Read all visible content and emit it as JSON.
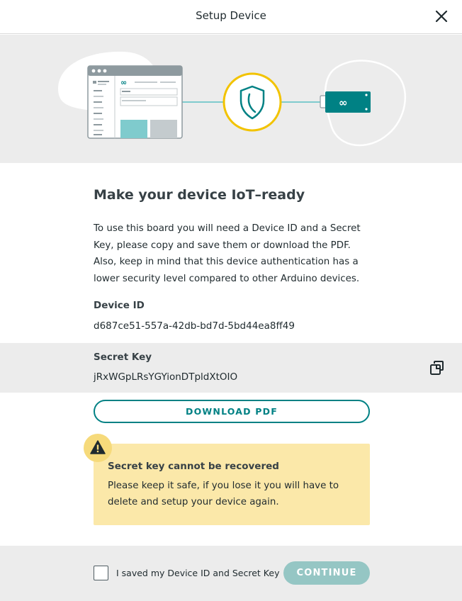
{
  "header": {
    "title": "Setup Device",
    "close_icon": "close-icon"
  },
  "hero": {
    "description_icons": [
      "browser-window-illustration",
      "shield-icon",
      "arduino-board-illustration"
    ],
    "accent_color": "#008184",
    "shield_ring_color": "#f2c300"
  },
  "main": {
    "title": "Make your device IoT–ready",
    "description": "To use this board you will need a Device ID and a Secret Key, please copy and save them or download the PDF. Also, keep in mind that this device authentication has a lower security level compared to other Arduino devices.",
    "device_id": {
      "label": "Device ID",
      "value": "d687ce51-557a-42db-bd7d-5bd44ea8ff49"
    },
    "secret_key": {
      "label": "Secret Key",
      "value": "jRxWGpLRsYGYionDTpldXtOIO",
      "copy_icon": "copy-icon"
    },
    "download_label": "DOWNLOAD PDF",
    "warning": {
      "icon": "warning-icon",
      "title": "Secret key cannot be recovered",
      "text": "Please keep it safe, if you lose it you will have to delete and setup your device again.",
      "background_color": "#fbe8a9"
    }
  },
  "footer": {
    "checkbox_label": "I saved my Device ID and Secret Key",
    "checkbox_checked": false,
    "continue_label": "CONTINUE",
    "continue_enabled": false
  }
}
